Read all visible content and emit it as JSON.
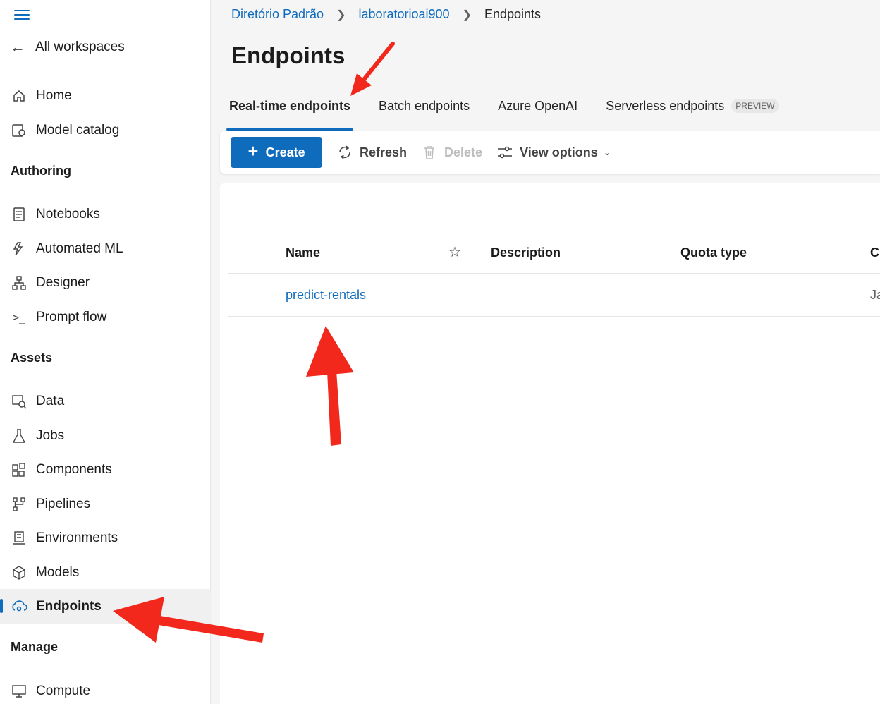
{
  "sidebar": {
    "back_label": "All workspaces",
    "top_items": [
      {
        "label": "Home",
        "icon": "home-icon"
      },
      {
        "label": "Model catalog",
        "icon": "catalog-icon"
      }
    ],
    "sections": [
      {
        "title": "Authoring",
        "items": [
          {
            "label": "Notebooks",
            "icon": "notebook-icon"
          },
          {
            "label": "Automated ML",
            "icon": "automl-icon"
          },
          {
            "label": "Designer",
            "icon": "designer-icon"
          },
          {
            "label": "Prompt flow",
            "icon": "prompt-flow-icon"
          }
        ]
      },
      {
        "title": "Assets",
        "items": [
          {
            "label": "Data",
            "icon": "data-icon"
          },
          {
            "label": "Jobs",
            "icon": "flask-icon"
          },
          {
            "label": "Components",
            "icon": "components-icon"
          },
          {
            "label": "Pipelines",
            "icon": "pipeline-icon"
          },
          {
            "label": "Environments",
            "icon": "environment-icon"
          },
          {
            "label": "Models",
            "icon": "cube-icon"
          },
          {
            "label": "Endpoints",
            "icon": "endpoint-icon",
            "active": true
          }
        ]
      },
      {
        "title": "Manage",
        "items": [
          {
            "label": "Compute",
            "icon": "compute-icon"
          }
        ]
      }
    ]
  },
  "breadcrumb": [
    "Diretório Padrão",
    "laboratorioai900",
    "Endpoints"
  ],
  "page_title": "Endpoints",
  "tabs": [
    {
      "label": "Real-time endpoints",
      "selected": true
    },
    {
      "label": "Batch endpoints"
    },
    {
      "label": "Azure OpenAI"
    },
    {
      "label": "Serverless endpoints",
      "badge": "PREVIEW"
    }
  ],
  "toolbar": {
    "create": "Create",
    "refresh": "Refresh",
    "delete": "Delete",
    "view_options": "View options"
  },
  "table": {
    "columns": [
      "Name",
      "Description",
      "Quota type",
      "C"
    ],
    "rows": [
      {
        "name": "predict-rentals",
        "description": "",
        "quota_type": "",
        "created": "Ja"
      }
    ]
  },
  "colors": {
    "accent": "#0f6cbd",
    "annotation_arrow": "#f2281c"
  }
}
